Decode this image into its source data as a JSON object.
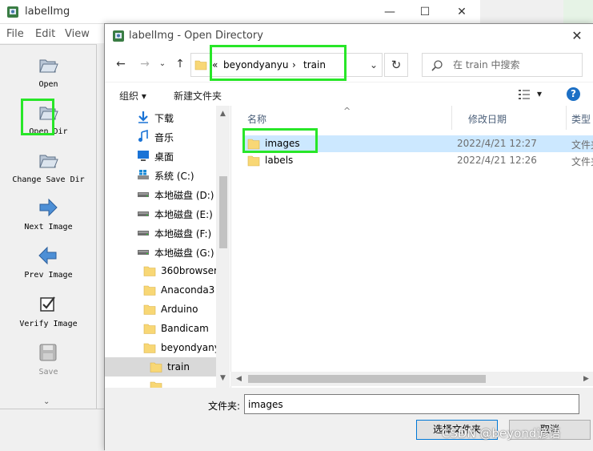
{
  "main_window": {
    "title": "labelImg",
    "menu": [
      "File",
      "Edit",
      "View"
    ],
    "window_controls": {
      "minimize": "—",
      "maximize": "☐",
      "close": "✕"
    },
    "tools": [
      {
        "label": "Open",
        "icon": "open-folder-icon"
      },
      {
        "label": "Open Dir",
        "icon": "open-folder-icon"
      },
      {
        "label": "Change Save Dir",
        "icon": "open-folder-icon"
      },
      {
        "label": "Next Image",
        "icon": "arrow-right-icon"
      },
      {
        "label": "Prev Image",
        "icon": "arrow-left-icon"
      },
      {
        "label": "Verify Image",
        "icon": "checkbox-icon"
      },
      {
        "label": "Save",
        "icon": "save-disk-icon"
      }
    ],
    "more_indicator": "⌄"
  },
  "dialog": {
    "title": "labelImg - Open Directory",
    "close": "✕",
    "nav": {
      "back": "←",
      "forward": "→",
      "up": "↑",
      "recent": "⌄"
    },
    "address": {
      "overflow": "«",
      "segments": [
        "beyondyanyu",
        "train"
      ],
      "separator": "›",
      "dropdown": "⌄"
    },
    "refresh": "↻",
    "search": {
      "placeholder": "在 train 中搜索"
    },
    "commands": {
      "organize": "组织 ▾",
      "new_folder": "新建文件夹",
      "view_arrow": "▾",
      "help": "?"
    },
    "nav_items": [
      {
        "label": "下载",
        "icon": "download-icon",
        "level": 1
      },
      {
        "label": "音乐",
        "icon": "music-icon",
        "level": 1
      },
      {
        "label": "桌面",
        "icon": "desktop-icon",
        "level": 1
      },
      {
        "label": "系统 (C:)",
        "icon": "windows-drive-icon",
        "level": 1
      },
      {
        "label": "本地磁盘 (D:)",
        "icon": "drive-icon",
        "level": 1
      },
      {
        "label": "本地磁盘 (E:)",
        "icon": "drive-icon",
        "level": 1
      },
      {
        "label": "本地磁盘 (F:)",
        "icon": "drive-icon",
        "level": 1
      },
      {
        "label": "本地磁盘 (G:)",
        "icon": "drive-icon",
        "level": 1
      },
      {
        "label": "360browser",
        "icon": "folder-icon",
        "level": 2
      },
      {
        "label": "Anaconda3",
        "icon": "folder-icon",
        "level": 2
      },
      {
        "label": "Arduino",
        "icon": "folder-icon",
        "level": 2
      },
      {
        "label": "Bandicam",
        "icon": "folder-icon",
        "level": 2
      },
      {
        "label": "beyondyany",
        "icon": "folder-icon",
        "level": 2
      },
      {
        "label": "train",
        "icon": "folder-icon",
        "level": 3,
        "selected": true
      },
      {
        "label": "",
        "icon": "folder-icon",
        "level": 3
      }
    ],
    "columns": {
      "name": "名称",
      "date": "修改日期",
      "type": "类型"
    },
    "files": [
      {
        "name": "images",
        "date": "2022/4/21 12:27",
        "type": "文件夹",
        "selected": true
      },
      {
        "name": "labels",
        "date": "2022/4/21 12:26",
        "type": "文件夹",
        "selected": false
      }
    ],
    "scroll_arrows": {
      "up": "▲",
      "down": "▼",
      "left": "◀",
      "right": "▶"
    },
    "folder_label": "文件夹:",
    "folder_value": "images",
    "select_button": "选择文件夹",
    "cancel_button": "取消"
  },
  "watermark": "CSDN @beyond谚语",
  "colors": {
    "highlight": "#28e628",
    "selection": "#cce8ff",
    "folder": "#f8d775",
    "accent": "#0078d7"
  }
}
